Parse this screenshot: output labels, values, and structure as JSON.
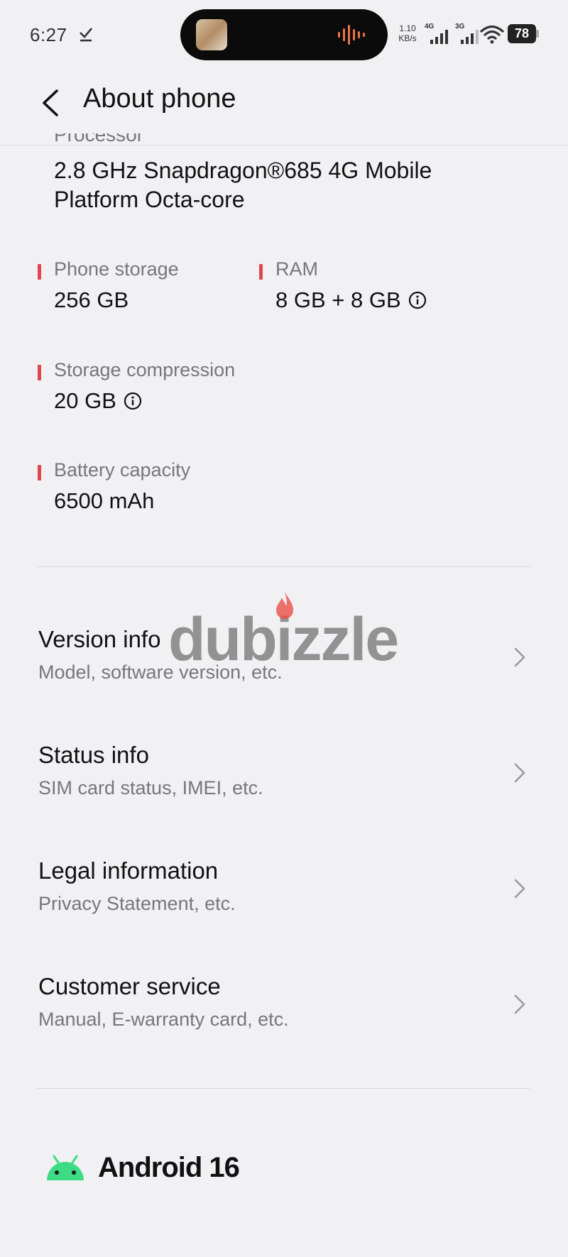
{
  "status_bar": {
    "time": "6:27",
    "net_speed_value": "1.10",
    "net_speed_unit": "KB/s",
    "signal1_label": "4G",
    "signal2_label": "3G",
    "battery": "78"
  },
  "header": {
    "title": "About phone"
  },
  "processor": {
    "label": "Processor",
    "value": "2.8 GHz Snapdragon®685 4G Mobile Platform Octa-core"
  },
  "specs": {
    "phone_storage": {
      "label": "Phone storage",
      "value": "256 GB"
    },
    "ram": {
      "label": "RAM",
      "value": "8 GB + 8 GB"
    },
    "storage_compression": {
      "label": "Storage compression",
      "value": "20 GB"
    },
    "battery_capacity": {
      "label": "Battery capacity",
      "value": "6500 mAh"
    }
  },
  "menu": {
    "items": [
      {
        "title": "Version info",
        "subtitle": "Model, software version, etc."
      },
      {
        "title": "Status info",
        "subtitle": "SIM card status, IMEI, etc."
      },
      {
        "title": "Legal information",
        "subtitle": "Privacy Statement, etc."
      },
      {
        "title": "Customer service",
        "subtitle": "Manual, E-warranty card, etc."
      }
    ]
  },
  "footer": {
    "android_label": "Android 16"
  },
  "watermark": {
    "text": "dubizzle"
  },
  "colors": {
    "accent_bar": "#e0474c",
    "android_green": "#3ddc84",
    "background": "#f1f1f4"
  }
}
